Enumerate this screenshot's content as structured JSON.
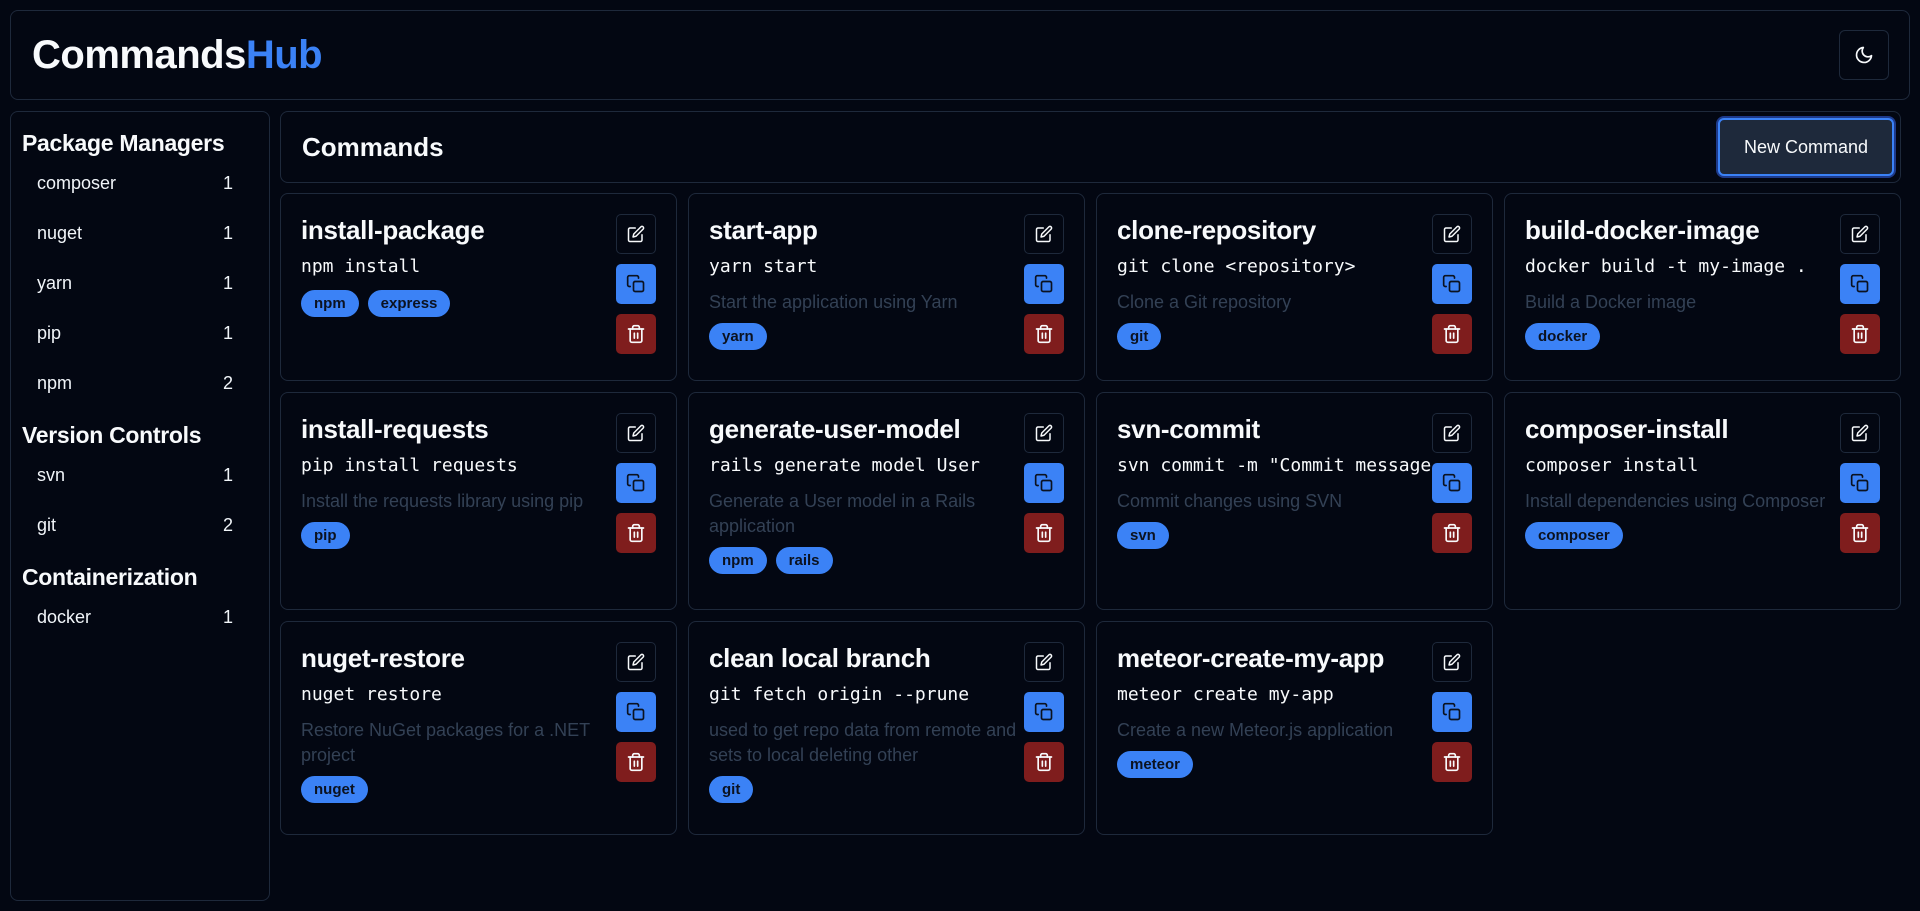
{
  "app": {
    "title_main": "Commands",
    "title_accent": "Hub"
  },
  "header": {
    "theme_icon": "moon-icon"
  },
  "sidebar": {
    "categories": [
      {
        "title": "Package Managers",
        "items": [
          {
            "label": "composer",
            "count": "1"
          },
          {
            "label": "nuget",
            "count": "1"
          },
          {
            "label": "yarn",
            "count": "1"
          },
          {
            "label": "pip",
            "count": "1"
          },
          {
            "label": "npm",
            "count": "2"
          }
        ]
      },
      {
        "title": "Version Controls",
        "items": [
          {
            "label": "svn",
            "count": "1"
          },
          {
            "label": "git",
            "count": "2"
          }
        ]
      },
      {
        "title": "Containerization",
        "items": [
          {
            "label": "docker",
            "count": "1"
          }
        ]
      }
    ]
  },
  "main": {
    "title": "Commands",
    "new_button": "New Command"
  },
  "commands": [
    {
      "title": "install-package",
      "command": "npm install",
      "description": "",
      "tags": [
        "npm",
        "express"
      ]
    },
    {
      "title": "start-app",
      "command": "yarn start",
      "description": "Start the application using Yarn",
      "tags": [
        "yarn"
      ]
    },
    {
      "title": "clone-repository",
      "command": "git clone <repository>",
      "description": "Clone a Git repository",
      "tags": [
        "git"
      ]
    },
    {
      "title": "build-docker-image",
      "command": "docker build -t my-image .",
      "description": "Build a Docker image",
      "tags": [
        "docker"
      ]
    },
    {
      "title": "install-requests",
      "command": "pip install requests",
      "description": "Install the requests library using pip",
      "tags": [
        "pip"
      ]
    },
    {
      "title": "generate-user-model",
      "command": "rails generate model User",
      "description": "Generate a User model in a Rails application",
      "tags": [
        "npm",
        "rails"
      ]
    },
    {
      "title": "svn-commit",
      "command": "svn commit -m \"Commit message",
      "description": "Commit changes using SVN",
      "tags": [
        "svn"
      ]
    },
    {
      "title": "composer-install",
      "command": "composer install",
      "description": "Install dependencies using Composer",
      "tags": [
        "composer"
      ]
    },
    {
      "title": "nuget-restore",
      "command": "nuget restore",
      "description": "Restore NuGet packages for a .NET project",
      "tags": [
        "nuget"
      ]
    },
    {
      "title": "clean local branch",
      "command": "git fetch origin --prune",
      "description": "used to get repo data from remote and sets to local deleting other",
      "tags": [
        "git"
      ]
    },
    {
      "title": "meteor-create-my-app",
      "command": "meteor create my-app",
      "description": "Create a new Meteor.js application",
      "tags": [
        "meteor"
      ]
    }
  ],
  "colors": {
    "background": "#030712",
    "accent": "#3b82f6",
    "danger": "#7f1d1d",
    "border": "#1e293b"
  }
}
